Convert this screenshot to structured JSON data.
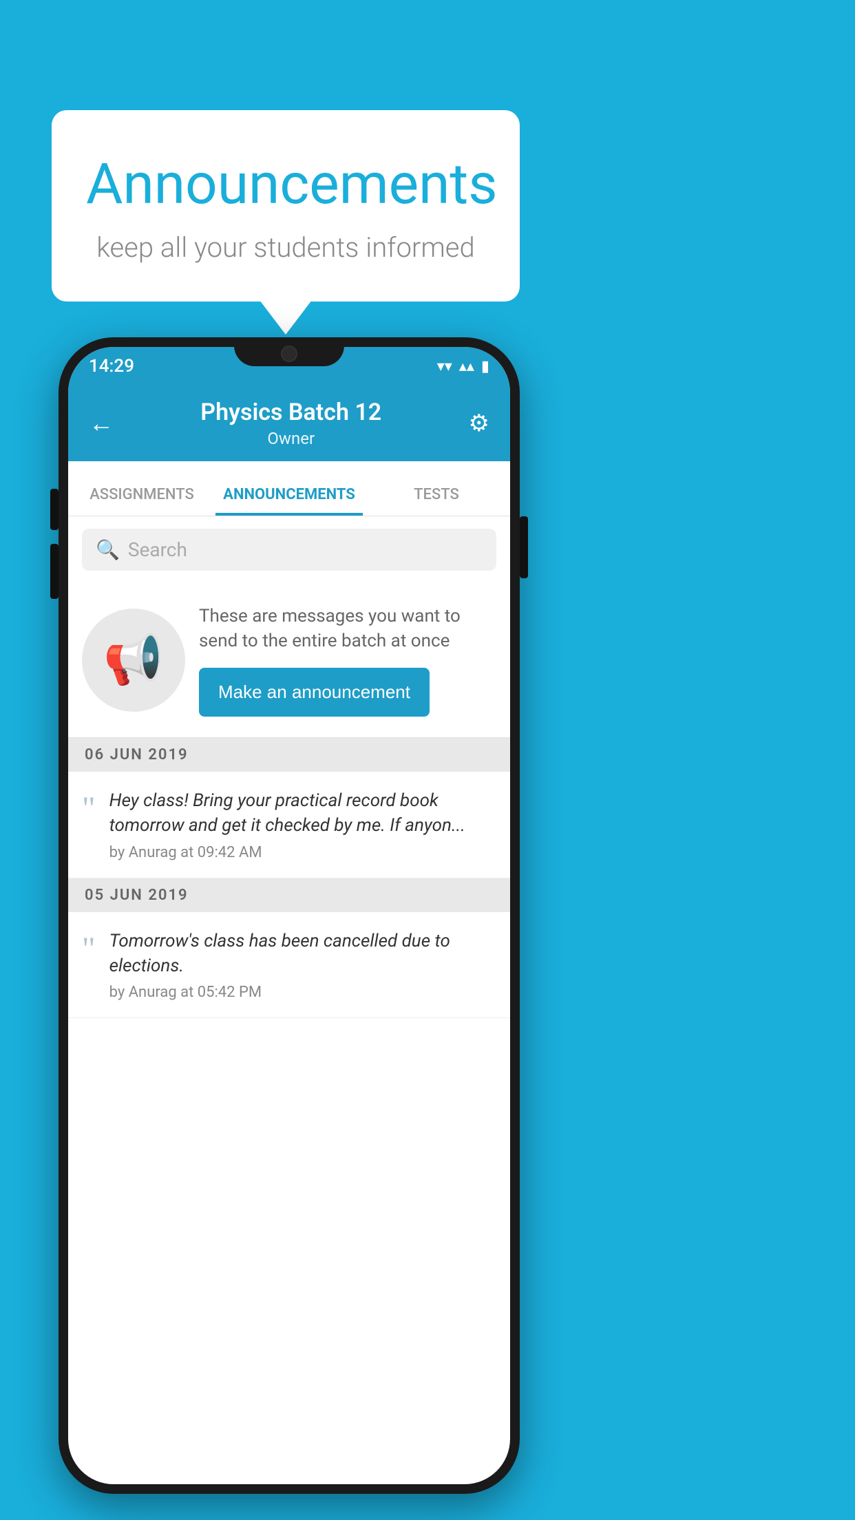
{
  "background_color": "#1AAEDB",
  "speech_bubble": {
    "title": "Announcements",
    "subtitle": "keep all your students informed"
  },
  "phone": {
    "status_bar": {
      "time": "14:29",
      "wifi": "▾",
      "signal": "▴",
      "battery": "▮"
    },
    "header": {
      "back_label": "←",
      "title": "Physics Batch 12",
      "subtitle": "Owner",
      "gear_label": "⚙"
    },
    "tabs": [
      {
        "label": "ASSIGNMENTS",
        "active": false
      },
      {
        "label": "ANNOUNCEMENTS",
        "active": true
      },
      {
        "label": "TESTS",
        "active": false
      }
    ],
    "search": {
      "placeholder": "Search"
    },
    "announcement_prompt": {
      "description": "These are messages you want to send to the entire batch at once",
      "button_label": "Make an announcement"
    },
    "announcement_groups": [
      {
        "date": "06  JUN  2019",
        "items": [
          {
            "text": "Hey class! Bring your practical record book tomorrow and get it checked by me. If anyon...",
            "meta": "by Anurag at 09:42 AM"
          }
        ]
      },
      {
        "date": "05  JUN  2019",
        "items": [
          {
            "text": "Tomorrow's class has been cancelled due to elections.",
            "meta": "by Anurag at 05:42 PM"
          }
        ]
      }
    ]
  }
}
